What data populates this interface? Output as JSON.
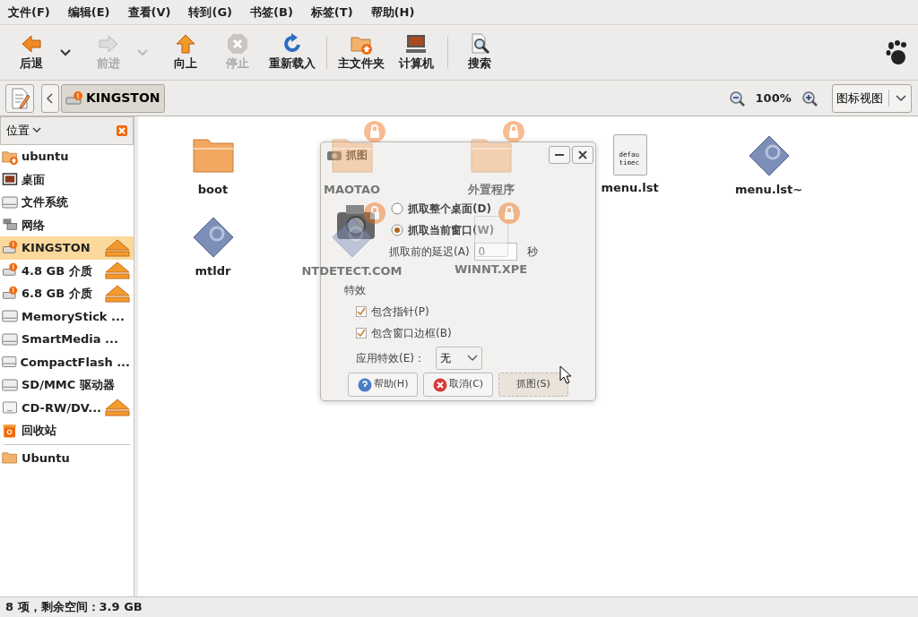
{
  "menu": [
    "文件(F)",
    "编辑(E)",
    "查看(V)",
    "转到(G)",
    "书签(B)",
    "标签(T)",
    "帮助(H)"
  ],
  "toolbar": [
    [
      {
        "kind": "back",
        "label": "后退",
        "disabled": false,
        "dropdown": true
      },
      {
        "kind": "forward",
        "label": "前进",
        "disabled": true,
        "dropdown": true
      },
      {
        "kind": "up",
        "label": "向上",
        "disabled": false,
        "dropdown": false
      },
      {
        "kind": "stop",
        "label": "停止",
        "disabled": true,
        "dropdown": false
      },
      {
        "kind": "reload",
        "label": "重新载入",
        "disabled": false,
        "dropdown": false
      }
    ],
    [
      {
        "kind": "home",
        "label": "主文件夹",
        "disabled": false,
        "dropdown": false
      },
      {
        "kind": "computer",
        "label": "计算机",
        "disabled": false,
        "dropdown": false
      }
    ],
    [
      {
        "kind": "search",
        "label": "搜索",
        "disabled": false,
        "dropdown": false
      }
    ]
  ],
  "location": {
    "path": "KINGSTON",
    "zoom": "100%",
    "view": "图标视图"
  },
  "sidebar": {
    "title": "位置",
    "groups": [
      [
        {
          "kind": "home",
          "label": "ubuntu",
          "eject": false,
          "selected": false
        },
        {
          "kind": "desktop",
          "label": "桌面",
          "eject": false,
          "selected": false
        },
        {
          "kind": "drive",
          "label": "文件系统",
          "eject": false,
          "selected": false
        },
        {
          "kind": "network",
          "label": "网络",
          "eject": false,
          "selected": false
        },
        {
          "kind": "usb",
          "label": "KINGSTON",
          "eject": true,
          "selected": true
        },
        {
          "kind": "usb",
          "label": "4.8 GB 介质",
          "eject": true,
          "selected": false
        },
        {
          "kind": "usb",
          "label": "6.8 GB 介质",
          "eject": true,
          "selected": false
        },
        {
          "kind": "drive",
          "label": "MemoryStick ...",
          "eject": false,
          "selected": false
        },
        {
          "kind": "drive",
          "label": "SmartMedia ...",
          "eject": false,
          "selected": false
        },
        {
          "kind": "drive",
          "label": "CompactFlash ...",
          "eject": false,
          "selected": false
        },
        {
          "kind": "drive",
          "label": "SD/MMC 驱动器",
          "eject": false,
          "selected": false
        },
        {
          "kind": "cdrom",
          "label": "CD-RW/DV...",
          "eject": true,
          "selected": false
        },
        {
          "kind": "trash",
          "label": "回收站",
          "eject": false,
          "selected": false
        }
      ],
      [
        {
          "kind": "folder",
          "label": "Ubuntu",
          "eject": false,
          "selected": false
        }
      ]
    ]
  },
  "files": [
    {
      "kind": "folder",
      "name": "boot",
      "locked": false
    },
    {
      "kind": "folder",
      "name": "MAOTAO",
      "locked": true
    },
    {
      "kind": "folder",
      "name": "外置程序",
      "locked": true
    },
    {
      "kind": "text",
      "name": "menu.lst",
      "locked": false,
      "preview": [
        "defau",
        "timec"
      ]
    },
    {
      "kind": "script",
      "name": "menu.lst~",
      "locked": false
    },
    {
      "kind": "script",
      "name": "mtldr",
      "locked": false
    },
    {
      "kind": "script",
      "name": "NTDETECT.COM",
      "locked": true
    },
    {
      "kind": "text",
      "name": "WINNT.XPE",
      "locked": true
    }
  ],
  "dialog": {
    "title": "抓图",
    "options": [
      {
        "label": "抓取整个桌面(D)",
        "selected": false
      },
      {
        "label": "抓取当前窗口(W)",
        "selected": true
      }
    ],
    "delay_label": "抓取前的延迟(A)",
    "delay": "0",
    "delay_unit": "秒",
    "effects_title": "特效",
    "checks": [
      {
        "label": "包含指针(P)",
        "checked": true
      },
      {
        "label": "包含窗口边框(B)",
        "checked": true
      }
    ],
    "effect_label": "应用特效(E)：",
    "effect": "无",
    "buttons": [
      {
        "kind": "help",
        "label": "帮助(H)"
      },
      {
        "kind": "cancel",
        "label": "取消(C)"
      },
      {
        "kind": "plain",
        "label": "抓图(S)"
      }
    ]
  },
  "status_bar": "8 项，剩余空间：3.9 GB"
}
